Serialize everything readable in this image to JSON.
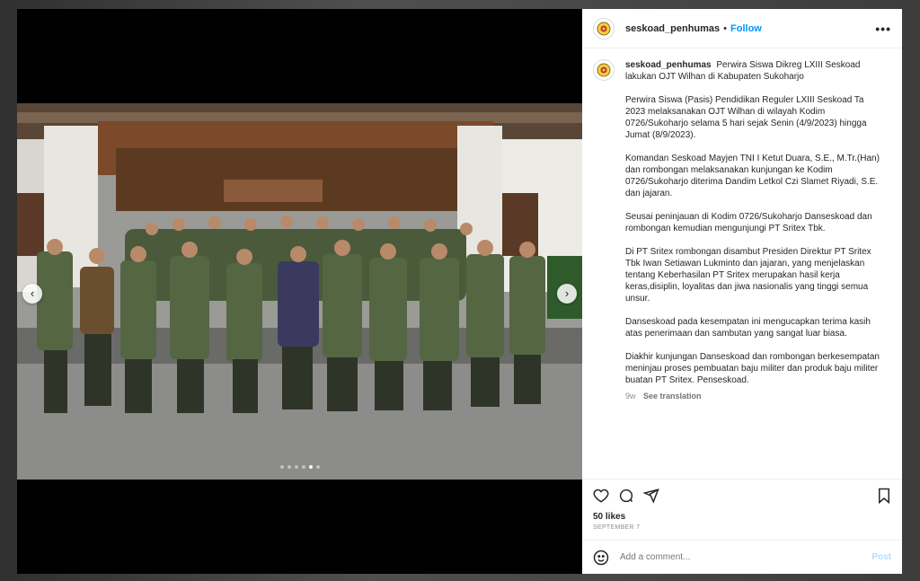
{
  "post": {
    "username": "seskoad_penhumas",
    "follow_label": "Follow",
    "caption_username": "seskoad_penhumas",
    "caption_paragraphs": [
      "Perwira Siswa Dikreg LXIII Seskoad lakukan OJT Wilhan di Kabupaten Sukoharjo",
      "Perwira Siswa (Pasis) Pendidikan Reguler LXIII Seskoad Ta 2023 melaksanakan OJT Wilhan di wilayah Kodim 0726/Sukoharjo selama 5 hari sejak Senin (4/9/2023) hingga Jumat (8/9/2023).",
      "Komandan Seskoad Mayjen TNI I Ketut Duara, S.E., M.Tr.(Han) dan rombongan melaksanakan kunjungan ke Kodim 0726/Sukoharjo diterima Dandim Letkol Czi Slamet Riyadi, S.E. dan jajaran.",
      "Seusai peninjauan di Kodim 0726/Sukoharjo Danseskoad dan rombongan kemudian mengunjungi PT Sritex Tbk.",
      "Di PT Sritex rombongan disambut Presiden Direktur PT Sritex Tbk Iwan Setiawan Lukminto dan jajaran, yang menjelaskan tentang Keberhasilan PT Sritex merupakan hasil kerja keras,disiplin, loyalitas dan jiwa nasionalis yang tinggi semua unsur.",
      "Danseskoad pada kesempatan ini mengucapkan terima kasih atas penerimaan dan sambutan yang sangat luar biasa.",
      "Diakhir kunjungan Danseskoad dan rombongan berkesempatan meninjau proses pembuatan baju militer dan produk baju militer buatan PT Sritex. Penseskoad."
    ],
    "age": "9w",
    "see_translation": "See translation",
    "likes": "50 likes",
    "date": "SEPTEMBER 7",
    "comment_placeholder": "Add a comment...",
    "post_label": "Post",
    "carousel": {
      "total": 6,
      "active_index": 4
    }
  },
  "icons": {
    "more": "more-horizontal-icon",
    "like": "heart-icon",
    "comment": "comment-icon",
    "share": "send-icon",
    "save": "bookmark-icon",
    "emoji": "emoji-icon",
    "prev": "chevron-left-icon",
    "next": "chevron-right-icon"
  },
  "colors": {
    "link_blue": "#0095f6",
    "post_disabled": "#b2dffc",
    "text": "#262626",
    "muted": "#8e8e8e"
  }
}
